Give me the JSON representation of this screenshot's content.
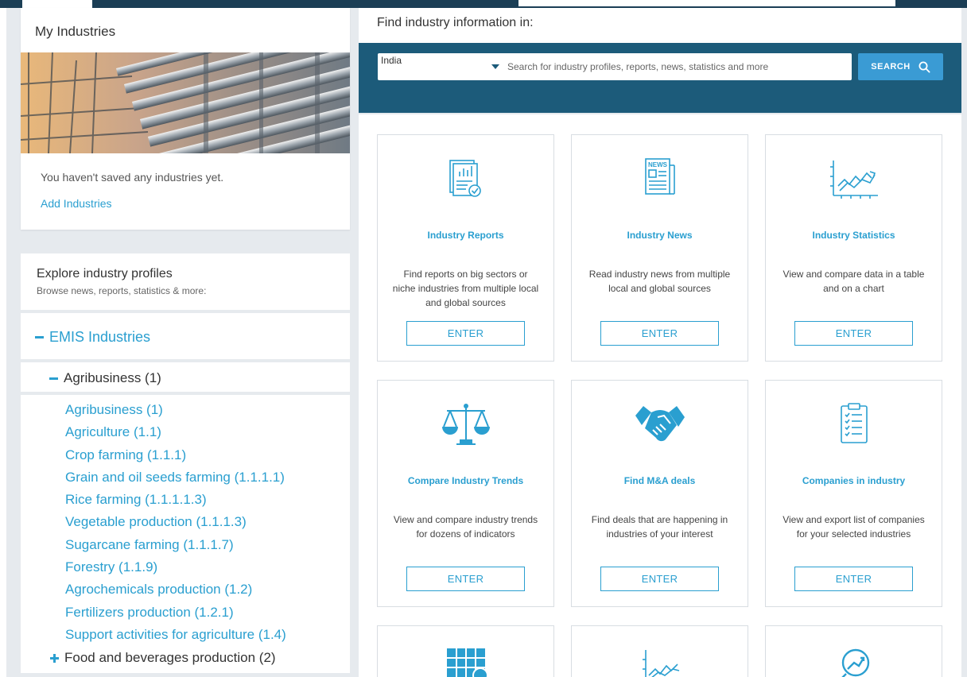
{
  "my_industries": {
    "title": "My Industries",
    "empty_message": "You haven't saved any industries yet.",
    "add_link": "Add Industries"
  },
  "explore": {
    "title": "Explore industry profiles",
    "subtitle": "Browse news, reports, statistics & more:",
    "root": "EMIS Industries",
    "group": "Agribusiness (1)",
    "items": [
      "Agribusiness (1)",
      "Agriculture (1.1)",
      "Crop farming (1.1.1)",
      "Grain and oil seeds farming (1.1.1.1)",
      "Rice farming (1.1.1.1.3)",
      "Vegetable production (1.1.1.3)",
      "Sugarcane farming (1.1.1.7)",
      "Forestry (1.1.9)",
      "Agrochemicals production (1.2)",
      "Fertilizers production (1.2.1)",
      "Support activities for agriculture (1.4)"
    ],
    "collapsed_group": "Food and beverages production (2)"
  },
  "search": {
    "heading": "Find industry information in:",
    "country": "India",
    "placeholder": "Search for industry profiles, reports, news, statistics and more",
    "button": "SEARCH"
  },
  "cards": [
    {
      "icon": "report-icon",
      "title": "Industry Reports",
      "desc": "Find reports on big sectors or niche industries from multiple local and global sources",
      "button": "ENTER"
    },
    {
      "icon": "news-icon",
      "title": "Industry News",
      "desc": "Read industry news from multiple local and global sources",
      "button": "ENTER"
    },
    {
      "icon": "statistics-chart-icon",
      "title": "Industry Statistics",
      "desc": "View and compare data in a table and on a chart",
      "button": "ENTER"
    },
    {
      "icon": "scales-icon",
      "title": "Compare Industry Trends",
      "desc": "View and compare industry trends for dozens of indicators",
      "button": "ENTER"
    },
    {
      "icon": "handshake-icon",
      "title": "Find M&A deals",
      "desc": "Find deals that are happening in industries of your interest",
      "button": "ENTER"
    },
    {
      "icon": "clipboard-checklist-icon",
      "title": "Companies in industry",
      "desc": "View and export list of companies for your selected industries",
      "button": "ENTER"
    }
  ],
  "colors": {
    "accent": "#2a9fd0",
    "header_band": "#1c5b7a",
    "search_button": "#3a9bd4",
    "top_bar": "#1b3e55"
  }
}
